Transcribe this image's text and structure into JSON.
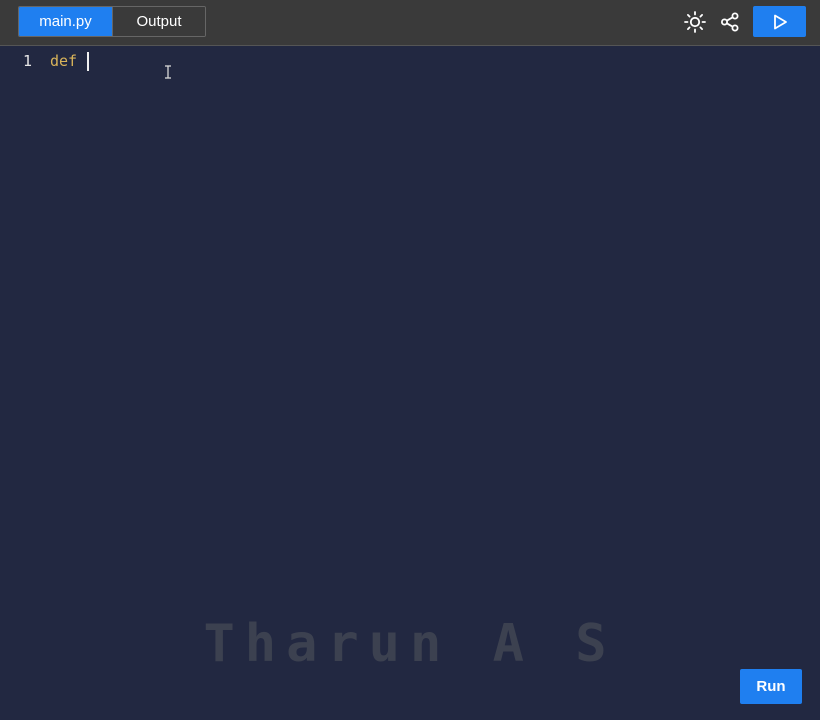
{
  "header": {
    "tabs": [
      {
        "label": "main.py",
        "active": true
      },
      {
        "label": "Output",
        "active": false
      }
    ],
    "icons": {
      "theme": "sun-icon",
      "share": "share-icon",
      "run": "play-icon"
    }
  },
  "editor": {
    "lines": [
      {
        "number": "1",
        "text": "def "
      }
    ]
  },
  "watermark": "Tharun A S",
  "run_button": {
    "label": "Run"
  },
  "colors": {
    "accent": "#1f7ff0",
    "editor_background": "#222841",
    "topbar_background": "#3a3a3a",
    "keyword": "#d9b45a"
  }
}
